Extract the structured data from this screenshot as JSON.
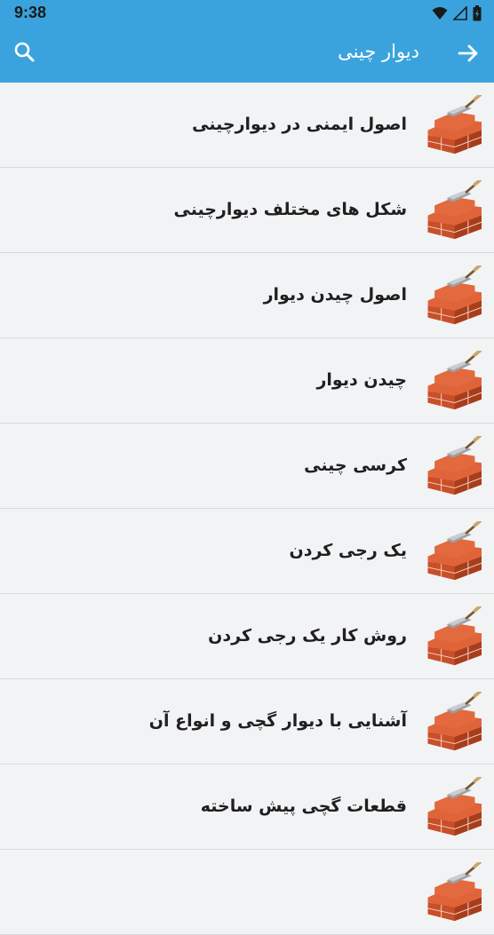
{
  "status": {
    "time": "9:38",
    "icons": [
      "wifi-icon",
      "signal-icon",
      "battery-icon"
    ]
  },
  "app_bar": {
    "title": "دیوار چینی",
    "back_icon": "arrow-right-icon",
    "search_icon": "search-icon"
  },
  "colors": {
    "primary": "#3aa3de",
    "background": "#f2f3f5",
    "divider": "#d9dadc",
    "brick": "#d9552e",
    "text": "#1f1f1f"
  },
  "list": {
    "item_icon": "brick-wall-trowel-icon",
    "items": [
      {
        "label": "اصول ایمنی در دیوارچینی"
      },
      {
        "label": "شکل های مختلف دیوارچینی"
      },
      {
        "label": "اصول چیدن دیوار"
      },
      {
        "label": "چیدن دیوار"
      },
      {
        "label": "کرسی چینی"
      },
      {
        "label": "یک رجی کردن"
      },
      {
        "label": "روش کار یک رجی کردن"
      },
      {
        "label": "آشنایی با دیوار گچی و انواع آن"
      },
      {
        "label": "قطعات گچی پیش ساخته"
      },
      {
        "label": ""
      }
    ]
  }
}
